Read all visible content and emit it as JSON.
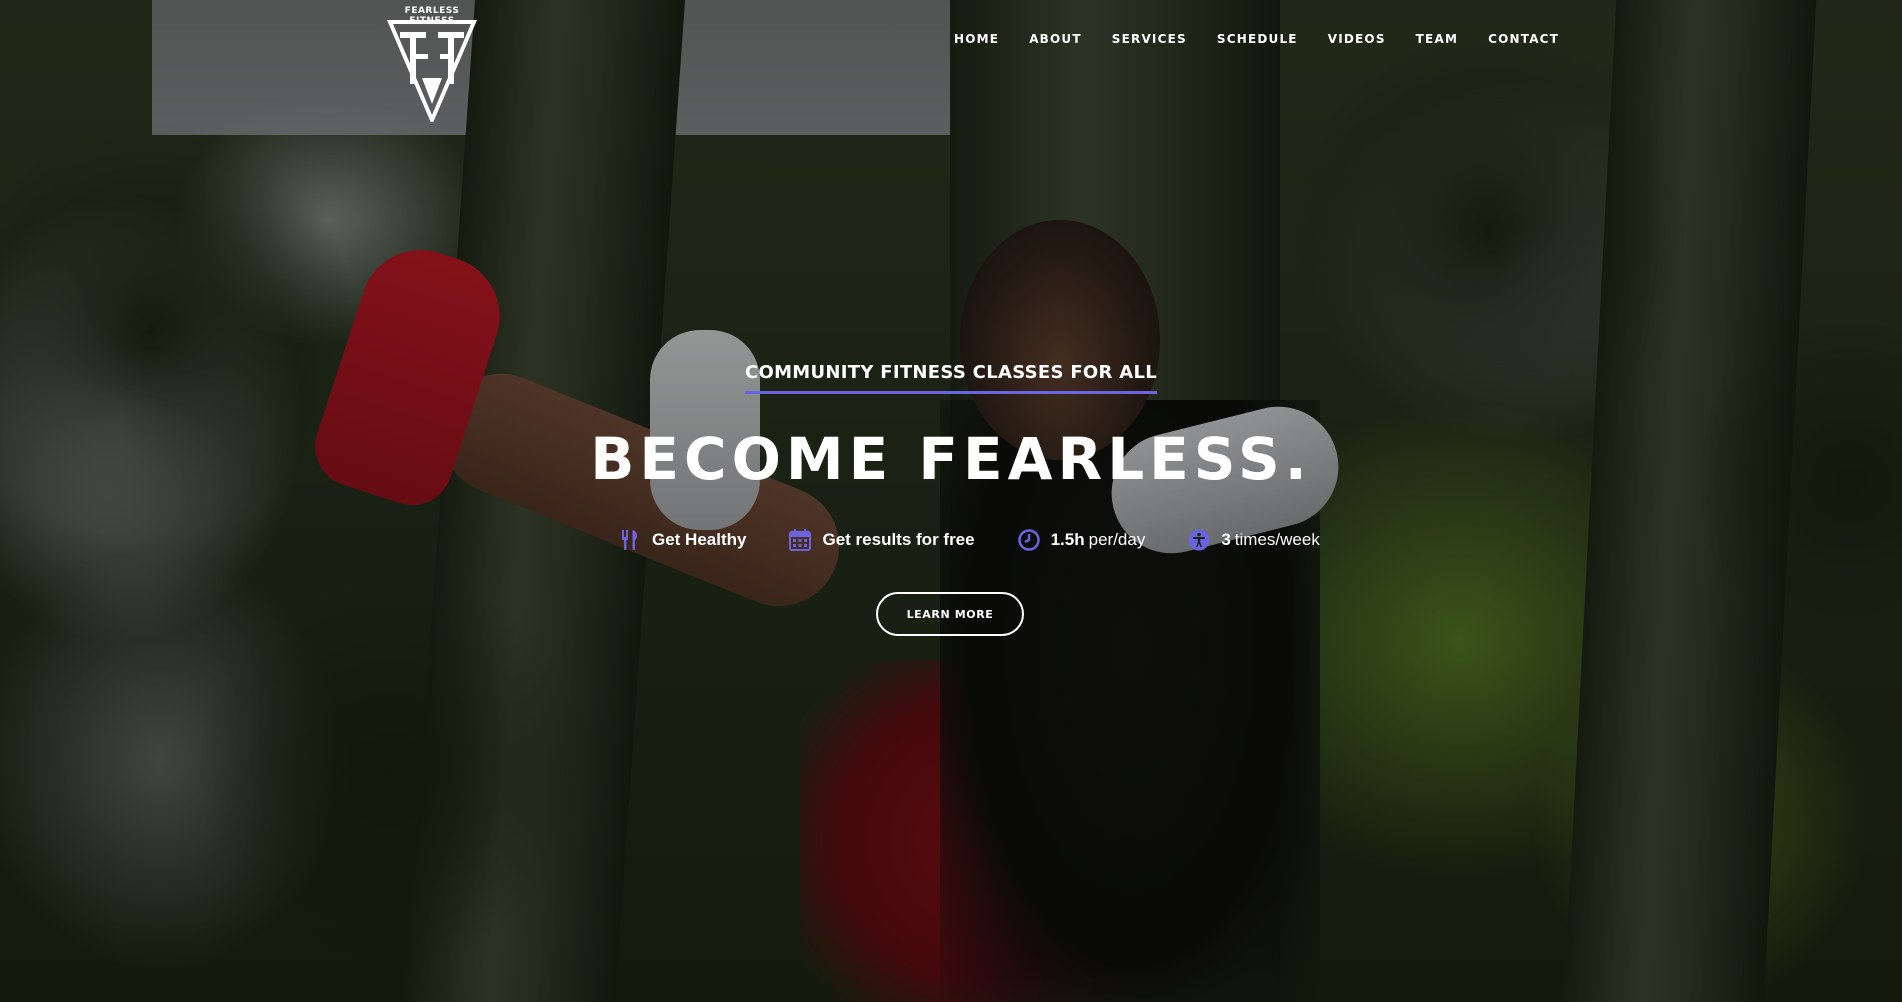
{
  "brand": {
    "logo_text": "FEARLESS FITNESS"
  },
  "nav": {
    "items": [
      {
        "label": "HOME"
      },
      {
        "label": "ABOUT"
      },
      {
        "label": "SERVICES"
      },
      {
        "label": "SCHEDULE"
      },
      {
        "label": "VIDEOS"
      },
      {
        "label": "TEAM"
      },
      {
        "label": "CONTACT"
      }
    ]
  },
  "hero": {
    "tagline": "COMMUNITY FITNESS CLASSES FOR ALL",
    "headline": "BECOME FEARLESS.",
    "features": [
      {
        "icon": "fork-knife-icon",
        "bold": "Get Healthy",
        "rest": ""
      },
      {
        "icon": "calendar-icon",
        "bold": "Get results for free",
        "rest": ""
      },
      {
        "icon": "clock-icon",
        "bold": "1.5h",
        "rest": "per/day"
      },
      {
        "icon": "accessibility-icon",
        "bold": "3",
        "rest": "times/week"
      }
    ],
    "cta_label": "LEARN MORE"
  },
  "colors": {
    "accent": "#6c63e0",
    "text": "#ffffff"
  }
}
